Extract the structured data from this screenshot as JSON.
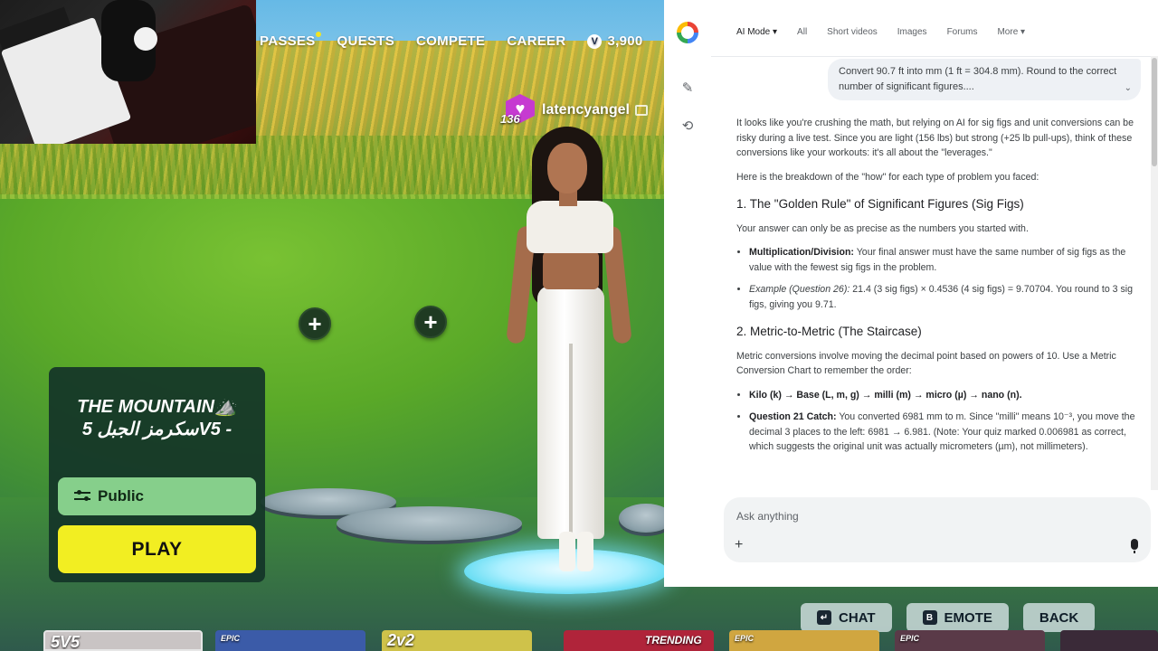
{
  "game": {
    "nav": {
      "passes": "PASSES",
      "quests": "QUESTS",
      "compete": "COMPETE",
      "career": "CAREER",
      "vbucks_amount": "3,900",
      "vbucks_symbol": "V"
    },
    "player": {
      "name": "latencyangel",
      "level": "136"
    },
    "matchmaking": {
      "title_line1": "THE MOUNTAIN⛰️",
      "title_line2": "سكرمز الجبل 5V5 -",
      "privacy": "Public",
      "play": "PLAY"
    },
    "bottom_buttons": {
      "chat": "CHAT",
      "chat_key": "↵",
      "emote": "EMOTE",
      "emote_key": "B",
      "back": "BACK"
    },
    "tiles": [
      {
        "label": "5V5",
        "color": "#c9c4c4"
      },
      {
        "label": "EPIC",
        "color": "#3b5ba8"
      },
      {
        "label": "2v2",
        "color": "#cfc24a"
      },
      {
        "label": "TRENDING",
        "color": "#b0243a"
      },
      {
        "label": "EPIC",
        "color": "#d0a640"
      },
      {
        "label": "EPIC",
        "color": "#5a3a48"
      }
    ]
  },
  "browser": {
    "tabs": {
      "ai_mode": "AI Mode ▾",
      "all": "All",
      "short_videos": "Short videos",
      "images": "Images",
      "forums": "Forums",
      "more": "More ▾"
    },
    "query": "Convert 90.7 ft into mm (1 ft = 304.8 mm). Round to the correct number of significant figures....",
    "answer": {
      "intro": "It looks like you're crushing the math, but relying on AI for sig figs and unit conversions can be risky during a live test. Since you are light (156 lbs) but strong (+25 lb pull-ups), think of these conversions like your workouts: it's all about the \"leverages.\"",
      "breakdown": "Here is the breakdown of the \"how\" for each type of problem you faced:",
      "h1": "1. The \"Golden Rule\" of Significant Figures (Sig Figs)",
      "h1_text": "Your answer can only be as precise as the numbers you started with.",
      "b1_label": "Multiplication/Division:",
      "b1_text": "Your final answer must have the same number of sig figs as the value with the fewest sig figs in the problem.",
      "b2_label": "Example (Question 26):",
      "b2_text": "21.4 (3 sig figs) × 0.4536 (4 sig figs) = 9.70704. You round to 3 sig figs, giving you 9.71.",
      "h2": "2. Metric-to-Metric (The Staircase)",
      "h2_text": "Metric conversions involve moving the decimal point based on powers of 10. Use a Metric Conversion Chart to remember the order:",
      "b3_text": "Kilo (k) → Base (L, m, g) → milli (m) → micro (µ) → nano (n).",
      "b4_label": "Question 21 Catch:",
      "b4_text": "You converted 6981 mm to m. Since \"milli\" means 10⁻³, you move the decimal 3 places to the left: 6981 → 6.981. (Note: Your quiz marked 0.006981 as correct, which suggests the original unit was actually micrometers (µm), not millimeters)."
    },
    "ask_placeholder": "Ask anything",
    "ask_plus": "+"
  }
}
